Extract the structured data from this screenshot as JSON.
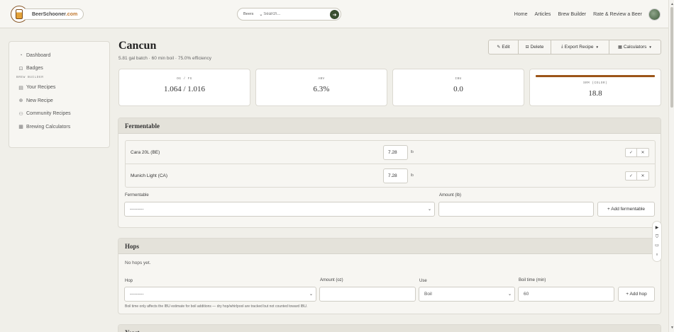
{
  "brand": {
    "name_part1": "BeerSchooner",
    "name_part2": ".com"
  },
  "search": {
    "category": "Beers",
    "placeholder": "Search..."
  },
  "nav": {
    "links": [
      "Home",
      "Articles",
      "Brew Builder",
      "Rate & Review a Beer"
    ]
  },
  "sidebar": {
    "items_top": [
      {
        "label": "Dashboard",
        "icon": "dashboard-icon"
      },
      {
        "label": "Badges",
        "icon": "badge-icon"
      }
    ],
    "section_label": "BREW BUILDER",
    "items_brew": [
      {
        "label": "Your Recipes",
        "icon": "recipe-icon"
      },
      {
        "label": "New Recipe",
        "icon": "plus-circle-icon"
      },
      {
        "label": "Community Recipes",
        "icon": "users-icon"
      },
      {
        "label": "Brewing Calculators",
        "icon": "calculator-icon"
      }
    ]
  },
  "recipe": {
    "title": "Cancun",
    "subtitle": "5.81 gal batch · 60 min boil · 75.0% efficiency"
  },
  "toolbar": {
    "edit": "Edit",
    "delete": "Delete",
    "export": "Export Recipe",
    "calculators": "Calculators"
  },
  "stats": [
    {
      "label": "OG / FG",
      "value": "1.064 / 1.016"
    },
    {
      "label": "ABV",
      "value": "6.3%"
    },
    {
      "label": "IBU",
      "value": "0.0"
    },
    {
      "label": "SRM (COLOR)",
      "value": "18.8",
      "color": "#9c5519"
    }
  ],
  "fermentables": {
    "heading": "Fermentable",
    "rows": [
      {
        "name": "Cara 20L (BE)",
        "amount": "7.28",
        "unit": "lb"
      },
      {
        "name": "Munich Light (CA)",
        "amount": "7.28",
        "unit": "lb"
      }
    ],
    "form": {
      "ferm_label": "Fermentable",
      "ferm_value": "---------",
      "amount_label": "Amount (lb)",
      "amount_value": "",
      "add_label": "+ Add fermentable"
    }
  },
  "hops": {
    "heading": "Hops",
    "empty_text": "No hops yet.",
    "form": {
      "hop_label": "Hop",
      "hop_value": "---------",
      "amount_label": "Amount (oz)",
      "amount_value": "",
      "use_label": "Use",
      "use_value": "Boil",
      "boil_label": "Boil time (min)",
      "boil_value": "60",
      "add_label": "+ Add hop"
    },
    "help": "Boil time only affects the IBU estimate for boil additions — dry hop/whirlpool are tracked but not counted toward IBU."
  },
  "yeast": {
    "heading": "Yeast"
  }
}
